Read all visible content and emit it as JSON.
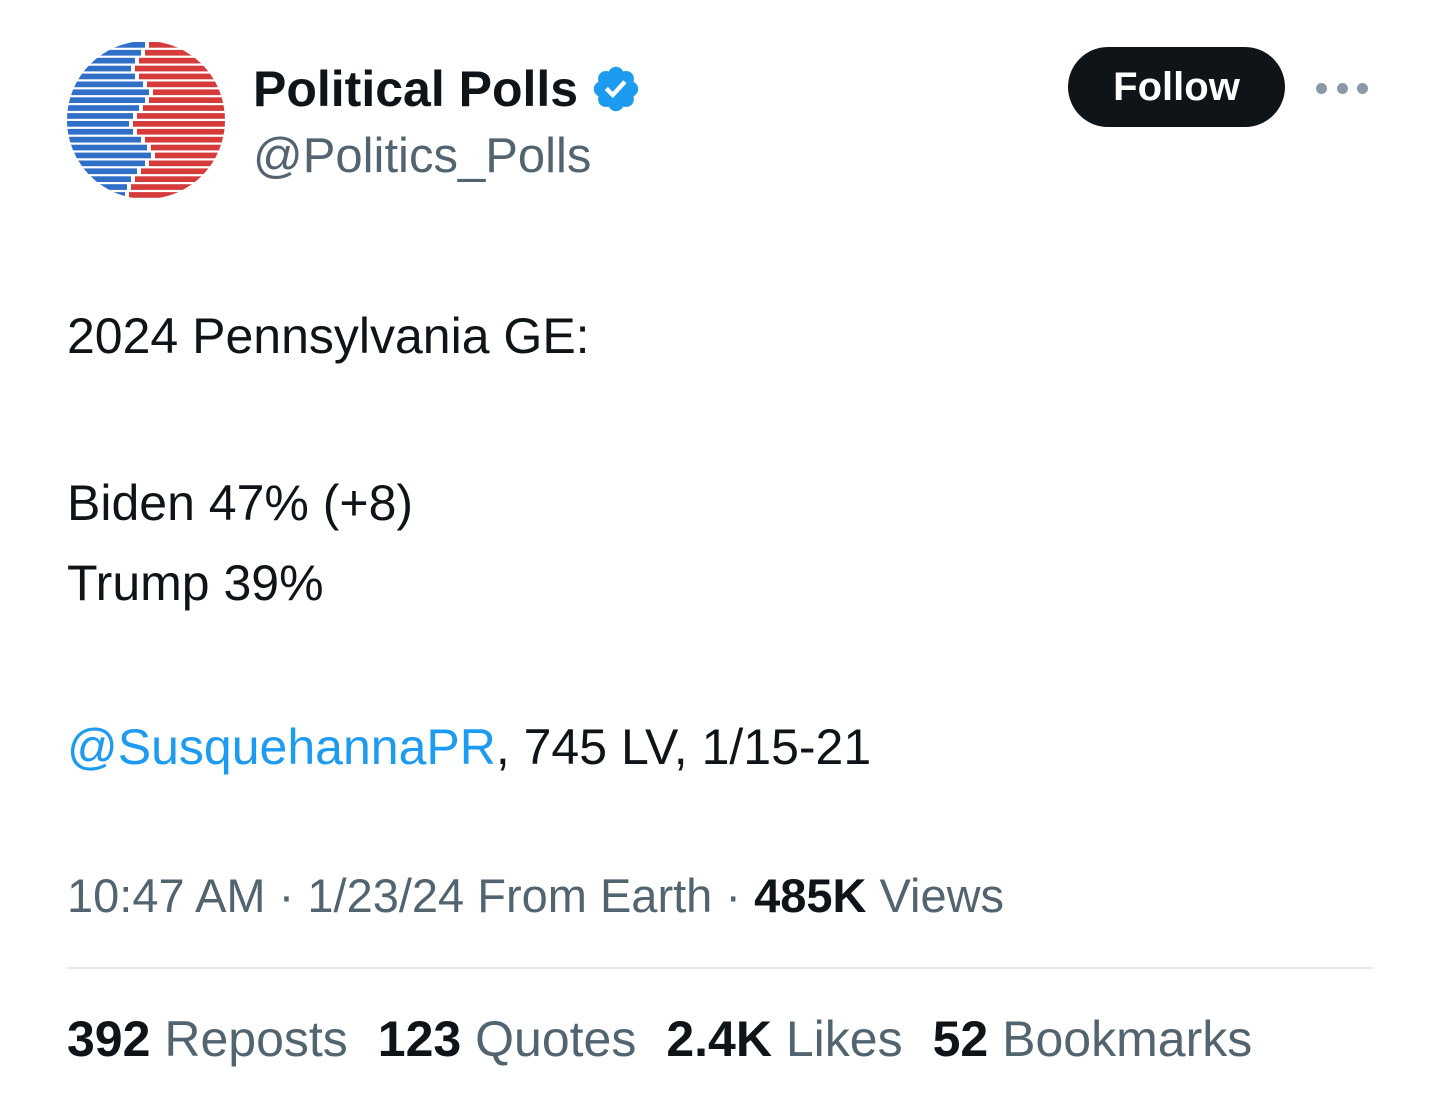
{
  "header": {
    "display_name": "Political Polls",
    "handle": "@Politics_Polls",
    "verified_icon": "verified-badge-icon",
    "follow_label": "Follow",
    "more_icon": "more-options-icon"
  },
  "tweet": {
    "line1": "2024 Pennsylvania GE:",
    "line2": "Biden 47% (+8)",
    "line3": "Trump 39%",
    "mention": "@SusquehannaPR",
    "mention_suffix": ", 745 LV, 1/15-21"
  },
  "meta": {
    "time": "10:47 AM",
    "date": "1/23/24",
    "source": "From Earth",
    "views_count": "485K",
    "views_label": "Views"
  },
  "stats": {
    "reposts_count": "392",
    "reposts_label": "Reposts",
    "quotes_count": "123",
    "quotes_label": "Quotes",
    "likes_count": "2.4K",
    "likes_label": "Likes",
    "bookmarks_count": "52",
    "bookmarks_label": "Bookmarks"
  },
  "colors": {
    "accent": "#1d9bf0",
    "follow_bg": "#0f1419",
    "secondary_text": "#536471",
    "avatar_blue": "#2f6fc7",
    "avatar_red": "#d63b3b"
  }
}
